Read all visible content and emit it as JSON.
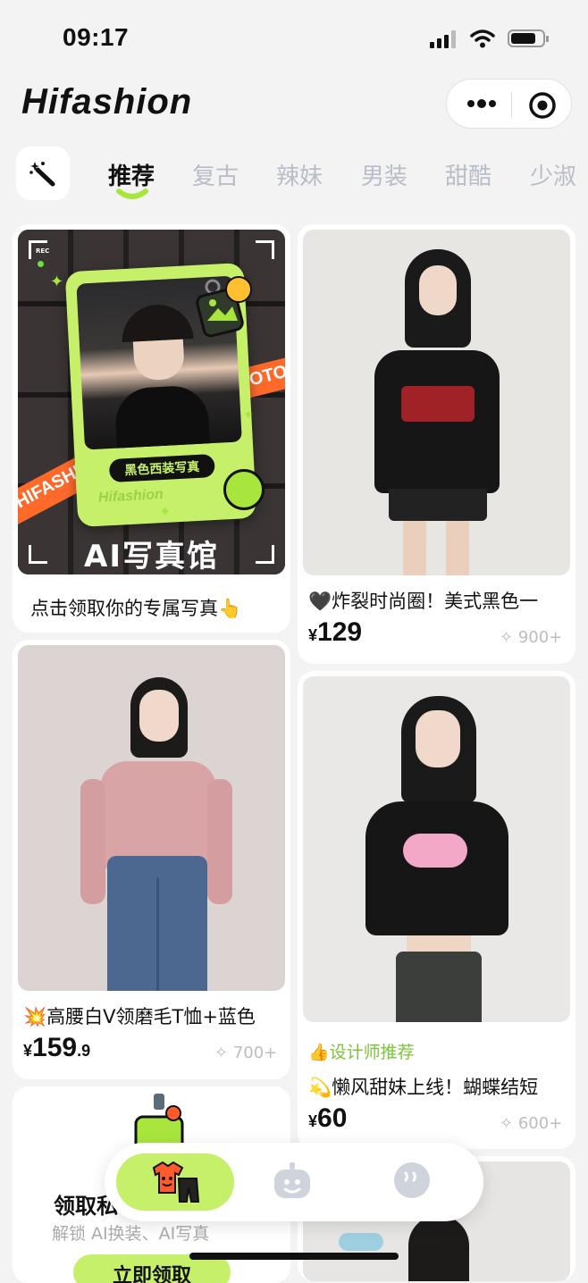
{
  "status_bar": {
    "time": "09:17"
  },
  "header": {
    "brand": "Hifashion"
  },
  "categories": [
    {
      "label": "推荐",
      "active": true
    },
    {
      "label": "复古"
    },
    {
      "label": "辣妹"
    },
    {
      "label": "男装"
    },
    {
      "label": "甜酷"
    },
    {
      "label": "少淑"
    }
  ],
  "promo_card": {
    "badge": "REC",
    "frame_label": "黑色西装写真",
    "frame_brand": "Hifashion",
    "ribbon_left": "HIFASHION",
    "ribbon_right": "AI PHOTO",
    "banner": "AI写真馆",
    "caption": "点击领取你的专属写真👆"
  },
  "products": [
    {
      "title": "🖤炸裂时尚圈！美式黑色一",
      "currency": "¥",
      "price": "129",
      "decimal": "",
      "count": "900+"
    },
    {
      "title": "💥高腰白V领磨毛T恤+蓝色",
      "currency": "¥",
      "price": "159",
      "decimal": ".9",
      "count": "700+"
    },
    {
      "tag": "设计师推荐",
      "title": "💫懒风甜妹上线！蝴蝶结短",
      "currency": "¥",
      "price": "60",
      "decimal": "",
      "count": "600+"
    }
  ],
  "claim_card": {
    "title": "领取私",
    "subtitle": "解锁 AI换装、AI写真",
    "button": "立即领取"
  },
  "colors": {
    "accent": "#c6f06a",
    "active_indicator": "#a8e63d",
    "tag_green": "#7cc43a"
  },
  "icons": [
    "magic-wand-icon",
    "more-dots-icon",
    "target-close-icon",
    "wardrobe-icon",
    "robot-icon",
    "chat-face-icon",
    "sparkle-count-icon",
    "thumbs-up-icon"
  ]
}
